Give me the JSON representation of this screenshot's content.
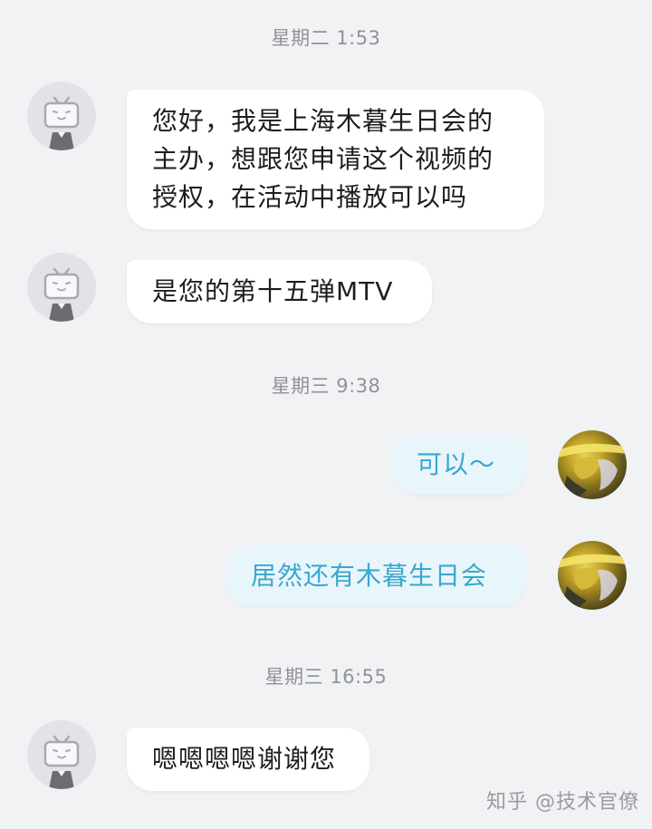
{
  "messages": {
    "t1": "星期二 1:53",
    "m1": "您好，我是上海木暮生日会的主办，想跟您申请这个视频的授权，在活动中播放可以吗",
    "m2": "是您的第十五弹MTV",
    "t2": "星期三 9:38",
    "m3": "可以～",
    "m4": "居然还有木暮生日会",
    "t3": "星期三 16:55",
    "m5": "嗯嗯嗯嗯谢谢您"
  },
  "watermark": "知乎 @技术官僚",
  "colors": {
    "background": "#f1f2f4",
    "incoming_bubble": "#ffffff",
    "outgoing_bubble": "#e8f6fb",
    "outgoing_text": "#3aa7cf",
    "timestamp_text": "#8f9297"
  },
  "icons": {
    "other_avatar": "bilibili-tv-icon",
    "self_avatar": "anime-avatar"
  }
}
